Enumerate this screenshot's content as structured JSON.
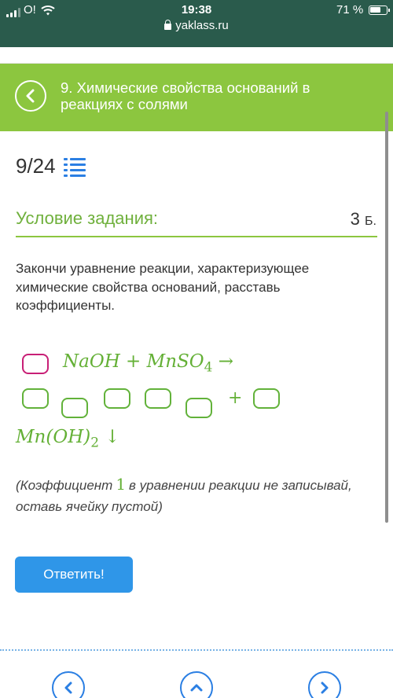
{
  "status_bar": {
    "carrier": "O!",
    "time": "19:38",
    "battery": "71 %",
    "battery_level": 0.71
  },
  "browser": {
    "url": "yaklass.ru"
  },
  "header": {
    "title": "9. Химические свойства оснований в реакциях с солями"
  },
  "progress": {
    "counter": "9/24"
  },
  "condition": {
    "title": "Условие задания:",
    "points_value": "3",
    "points_unit": "Б."
  },
  "task": {
    "text": "Закончи уравнение реакции, характеризующее химические свойства оснований, расставь коэффициенты."
  },
  "equation": {
    "reactants": "NaOH + MnSO",
    "reactant_sub": "4",
    "arrow": "→",
    "plus": "+",
    "product": "Mn(OH)",
    "product_sub": "2",
    "precipitate": "↓"
  },
  "hint": {
    "before": "(Коэффициент",
    "number": "1",
    "after": "в уравнении реакции не записывай, оставь ячейку пустой)"
  },
  "actions": {
    "answer_label": "Ответить!"
  },
  "colors": {
    "status_bg": "#2a5b4c",
    "header_green": "#8cc63f",
    "formula_green": "#64b036",
    "active_box": "#c81f76",
    "button_blue": "#2f96e8"
  }
}
